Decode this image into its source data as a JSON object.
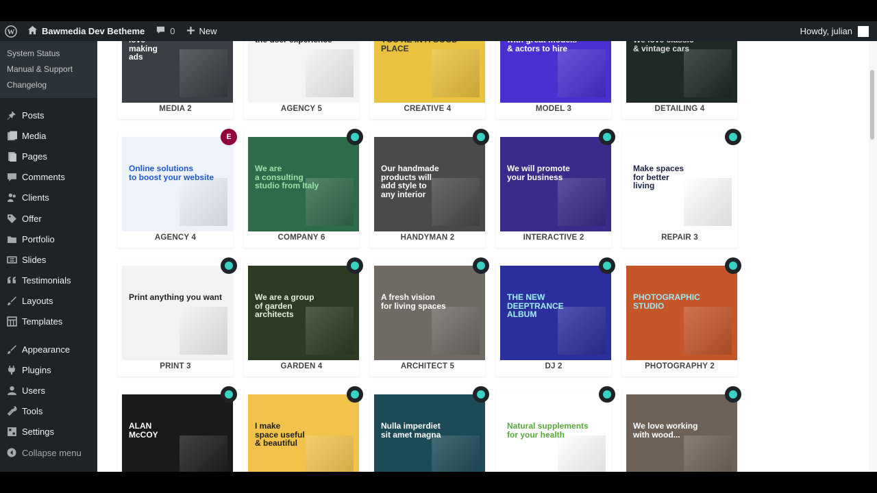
{
  "adminbar": {
    "site_name": "Bawmedia Dev Betheme",
    "comments_count": "0",
    "new_label": "New",
    "howdy": "Howdy, julian"
  },
  "sidebar": {
    "submenu": [
      "System Status",
      "Manual & Support",
      "Changelog"
    ],
    "items": [
      {
        "label": "Posts",
        "icon": "pin-icon"
      },
      {
        "label": "Media",
        "icon": "media-icon"
      },
      {
        "label": "Pages",
        "icon": "pages-icon"
      },
      {
        "label": "Comments",
        "icon": "comment-icon"
      },
      {
        "label": "Clients",
        "icon": "users-icon"
      },
      {
        "label": "Offer",
        "icon": "tag-icon"
      },
      {
        "label": "Portfolio",
        "icon": "folder-icon"
      },
      {
        "label": "Slides",
        "icon": "slides-icon"
      },
      {
        "label": "Testimonials",
        "icon": "quote-icon"
      },
      {
        "label": "Layouts",
        "icon": "brush-icon"
      },
      {
        "label": "Templates",
        "icon": "grid-icon"
      }
    ],
    "items2": [
      {
        "label": "Appearance",
        "icon": "brush-icon"
      },
      {
        "label": "Plugins",
        "icon": "plug-icon"
      },
      {
        "label": "Users",
        "icon": "user-icon"
      },
      {
        "label": "Tools",
        "icon": "wrench-icon"
      },
      {
        "label": "Settings",
        "icon": "settings-icon"
      }
    ],
    "collapse_label": "Collapse menu"
  },
  "templates": [
    {
      "name": "MEDIA 2",
      "badge": "",
      "bg": "#3a3f45",
      "text": "love\nmaking\nads",
      "tcolor": "#ffffff"
    },
    {
      "name": "AGENCY 5",
      "badge": "",
      "bg": "#f4f4f4",
      "text": "the user experience",
      "tcolor": "#222222"
    },
    {
      "name": "CREATIVE 4",
      "badge": "",
      "bg": "#e9c23f",
      "text": "YOU'RE IN A GOOD PLACE",
      "tcolor": "#333333"
    },
    {
      "name": "MODEL 3",
      "badge": "",
      "bg": "#4b2fd0",
      "text": "with great models\n& actors to hire",
      "tcolor": "#ffffff"
    },
    {
      "name": "DETAILING 4",
      "badge": "",
      "bg": "#1f2a24",
      "text": "We love classic\n& vintage cars",
      "tcolor": "#dddddd"
    },
    {
      "name": "AGENCY 4",
      "badge": "elementor",
      "bg": "#eef3fb",
      "text": "Online solutions\nto boost your website",
      "tcolor": "#1e57d8"
    },
    {
      "name": "COMPANY 6",
      "badge": "be",
      "bg": "#2f6b4a",
      "text": "We are\na consulting\nstudio from Italy",
      "tcolor": "#9fe0a8"
    },
    {
      "name": "HANDYMAN 2",
      "badge": "be",
      "bg": "#4a4a4a",
      "text": "Our handmade\nproducts will\nadd style to\nany interior",
      "tcolor": "#ffffff"
    },
    {
      "name": "INTERACTIVE 2",
      "badge": "be",
      "bg": "#3a2a8a",
      "text": "We will promote\nyour business",
      "tcolor": "#ffffff"
    },
    {
      "name": "REPAIR 3",
      "badge": "be",
      "bg": "#ffffff",
      "text": "Make spaces\nfor better\nliving",
      "tcolor": "#1b2340"
    },
    {
      "name": "PRINT 3",
      "badge": "be",
      "bg": "#f2f3f5",
      "text": "Print anything you want",
      "tcolor": "#222222"
    },
    {
      "name": "GARDEN 4",
      "badge": "be",
      "bg": "#2d3b22",
      "text": "We are a group\nof garden\narchitects",
      "tcolor": "#e6eddc"
    },
    {
      "name": "ARCHITECT 5",
      "badge": "be",
      "bg": "#6f6a64",
      "text": "A fresh vision\nfor living spaces",
      "tcolor": "#ffffff"
    },
    {
      "name": "DJ 2",
      "badge": "be",
      "bg": "#2b2f9e",
      "text": "THE NEW\nDEEPTRANCE\nALBUM",
      "tcolor": "#9ff0ff"
    },
    {
      "name": "PHOTOGRAPHY 2",
      "badge": "be",
      "bg": "#c4562a",
      "text": "PHOTOGRAPHIC\nSTUDIO",
      "tcolor": "#9fe8f5"
    },
    {
      "name": "",
      "badge": "be",
      "bg": "#1a1a1a",
      "text": "ALAN\nMcCOY",
      "tcolor": "#ffffff"
    },
    {
      "name": "",
      "badge": "be",
      "bg": "#f1c34b",
      "text": "I make\nspace useful\n& beautiful",
      "tcolor": "#1d1d1d"
    },
    {
      "name": "",
      "badge": "be",
      "bg": "#1c4a57",
      "text": "Nulla imperdiet\nsit amet magna",
      "tcolor": "#ffffff"
    },
    {
      "name": "",
      "badge": "be",
      "bg": "#ffffff",
      "text": "Natural supplements\nfor your health",
      "tcolor": "#5aa63a"
    },
    {
      "name": "",
      "badge": "be",
      "bg": "#6e6258",
      "text": "We love working\nwith wood...",
      "tcolor": "#ffffff"
    }
  ]
}
